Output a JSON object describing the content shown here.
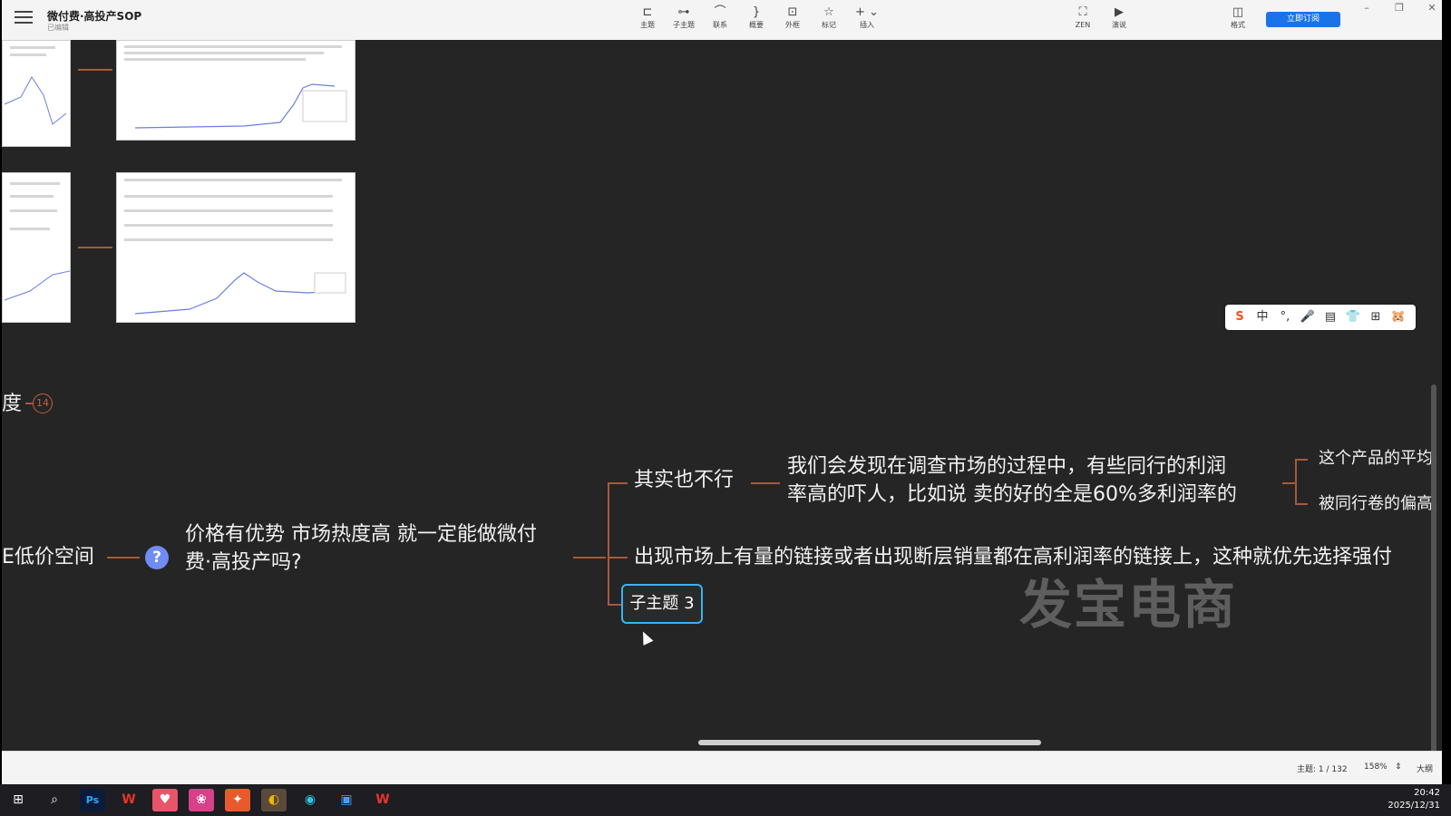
{
  "app": {
    "doc_title": "微付费·高投产SOP",
    "doc_status": "已编辑"
  },
  "toolbar": {
    "tools": [
      {
        "label": "主题",
        "icon": "topic-icon"
      },
      {
        "label": "子主题",
        "icon": "subtopic-icon"
      },
      {
        "label": "联系",
        "icon": "relationship-icon"
      },
      {
        "label": "概要",
        "icon": "summary-icon"
      },
      {
        "label": "外框",
        "icon": "boundary-icon"
      },
      {
        "label": "标记",
        "icon": "marker-icon"
      },
      {
        "label": "插入",
        "icon": "insert-icon"
      }
    ],
    "right_tools": [
      {
        "label": "ZEN",
        "icon": "zen-icon"
      },
      {
        "label": "演说",
        "icon": "pitch-icon"
      },
      {
        "label": "格式",
        "icon": "format-panel-icon"
      }
    ],
    "subscribe_label": "立即订阅"
  },
  "mindmap": {
    "left_partial_node": "度",
    "badge_count": "14",
    "price_node": "E低价空间",
    "question_node": "价格有优势 市场热度高  就一定能做微付",
    "question_node_line2": "费·高投产吗?",
    "branch1": "其实也不行",
    "branch1_detail_line1": "我们会发现在调查市场的过程中，有些同行的利润",
    "branch1_detail_line2": "率高的吓人，比如说 卖的好的全是60%多利润率的",
    "leaf1": "这个产品的平均",
    "leaf2": "被同行卷的偏高",
    "branch2": "出现市场上有量的链接或者出现断层销量都在高利润率的链接上，这种就优先选择强付",
    "selected_subtopic": "子主题 3",
    "watermark": "发宝电商"
  },
  "ime_toolbar": {
    "items": [
      "S",
      "中",
      "°,",
      "🎤",
      "▤",
      "👕",
      "⊞",
      "🐹"
    ]
  },
  "statusbar": {
    "topic_count": "主题: 1 / 132",
    "zoom": "158%",
    "outline_label": "大纲"
  },
  "taskbar": {
    "time": "20:42",
    "date": "2025/12/31"
  }
}
